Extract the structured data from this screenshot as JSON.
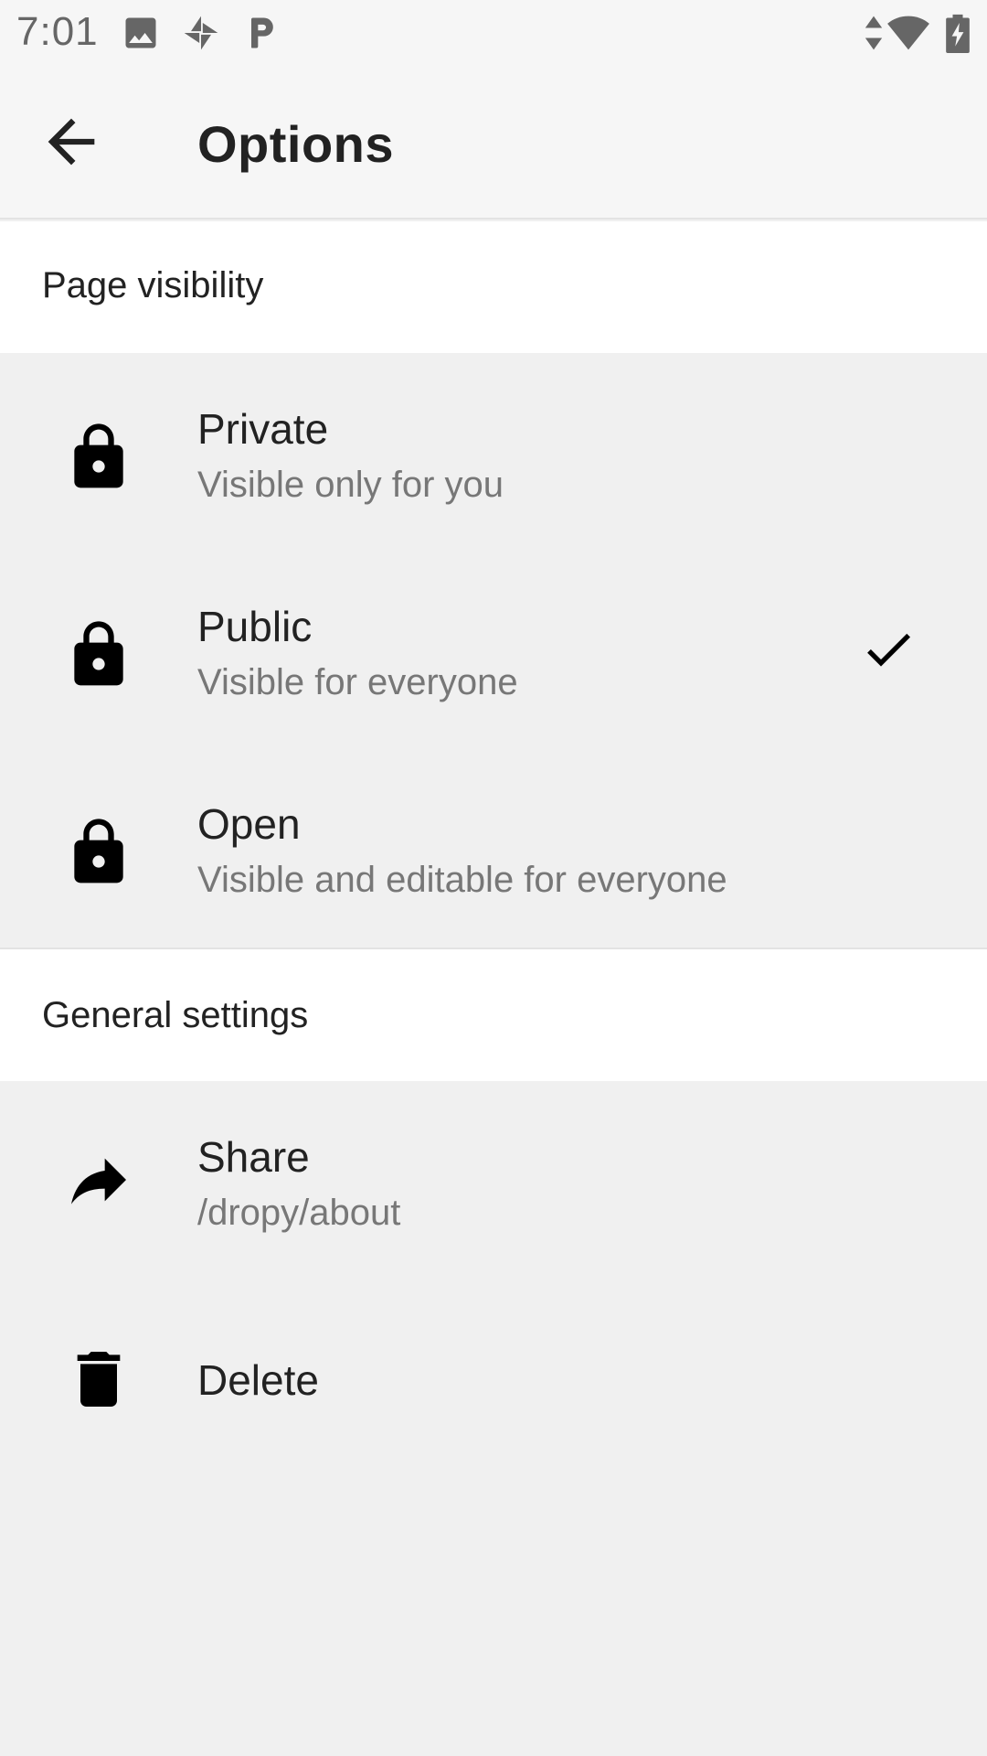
{
  "status_bar": {
    "time": "7:01",
    "left_icons": [
      "image-icon",
      "pinwheel-icon",
      "p-app-icon"
    ],
    "right_icons": [
      "data-arrows-icon",
      "wifi-icon",
      "battery-charging-icon"
    ]
  },
  "app_bar": {
    "title": "Options",
    "back_icon": "arrow-back-icon"
  },
  "sections": {
    "visibility": {
      "header": "Page visibility",
      "items": [
        {
          "title": "Private",
          "subtitle": "Visible only for you",
          "icon": "lock-icon",
          "selected": false
        },
        {
          "title": "Public",
          "subtitle": "Visible for everyone",
          "icon": "lock-icon",
          "selected": true
        },
        {
          "title": "Open",
          "subtitle": "Visible and editable for everyone",
          "icon": "lock-icon",
          "selected": false
        }
      ]
    },
    "general": {
      "header": "General settings",
      "items": [
        {
          "title": "Share",
          "subtitle": "/dropy/about",
          "icon": "share-icon"
        },
        {
          "title": "Delete",
          "icon": "delete-icon"
        }
      ]
    }
  },
  "colors": {
    "background": "#f0f0f0",
    "header_background": "#ffffff",
    "primary_text": "#222222",
    "secondary_text": "#777777"
  }
}
